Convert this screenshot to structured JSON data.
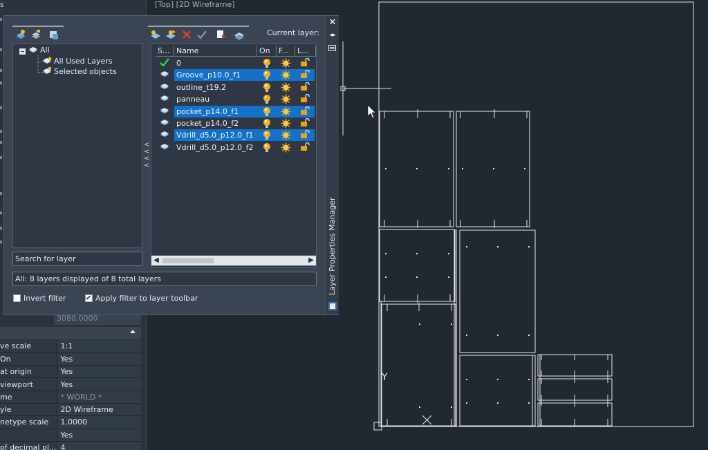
{
  "viewport": {
    "caption": "[Top] [2D Wireframe]"
  },
  "properties": {
    "title_fragment": "s",
    "top_value": "3080.0000",
    "rows": [
      {
        "key": "ve scale",
        "value": "1:1",
        "dim": false
      },
      {
        "key": " On",
        "value": "Yes",
        "dim": false
      },
      {
        "key": " at origin",
        "value": "Yes",
        "dim": false
      },
      {
        "key": "viewport",
        "value": "Yes",
        "dim": false
      },
      {
        "key": "me",
        "value": "* WORLD *",
        "dim": true
      },
      {
        "key": "yle",
        "value": "2D Wireframe",
        "dim": false
      },
      {
        "key": "netype scale",
        "value": "1.0000",
        "dim": false
      },
      {
        "key": "",
        "value": "Yes",
        "dim": false
      },
      {
        "key": "of decimal pl...",
        "value": "4",
        "dim": false
      }
    ]
  },
  "layer_manager": {
    "title": "Layer Properties Manager",
    "current_layer_label": "Current layer:",
    "close_glyph": "✕",
    "pin_glyph": "◂▸",
    "tree": {
      "root": "All",
      "children": [
        "All Used Layers",
        "Selected objects"
      ]
    },
    "search_placeholder": "Search for layer",
    "columns": {
      "status": "S...",
      "name": "Name",
      "on": "On",
      "freeze": "F...",
      "lock": "L..."
    },
    "layers": [
      {
        "name": "0",
        "selected": false,
        "current": true
      },
      {
        "name": "Groove_p10.0_f1",
        "selected": true,
        "current": false
      },
      {
        "name": "outline_t19.2",
        "selected": false,
        "current": false
      },
      {
        "name": "panneau",
        "selected": false,
        "current": false
      },
      {
        "name": "pocket_p14.0_f1",
        "selected": true,
        "current": false
      },
      {
        "name": "pocket_p14.0_f2",
        "selected": false,
        "current": false
      },
      {
        "name": "Vdrill_d5.0_p12.0_f1",
        "selected": true,
        "current": false
      },
      {
        "name": "Vdrill_d5.0_p12.0_f2",
        "selected": false,
        "current": false
      }
    ],
    "status_text": "All: 8 layers displayed of 8 total layers",
    "invert_filter": {
      "label": "Invert filter",
      "checked": false
    },
    "apply_filter": {
      "label": "Apply filter to layer toolbar",
      "checked": true
    },
    "scroll": {
      "left": "◀",
      "right": "▶"
    },
    "splitter_glyph": "<"
  },
  "drawing": {
    "ucs_y": "Y"
  },
  "colors": {
    "background": "#212830",
    "panel": "#3b4452",
    "selection": "#1471c9",
    "bulb": "#f2b21b",
    "sun": "#e8a317"
  }
}
